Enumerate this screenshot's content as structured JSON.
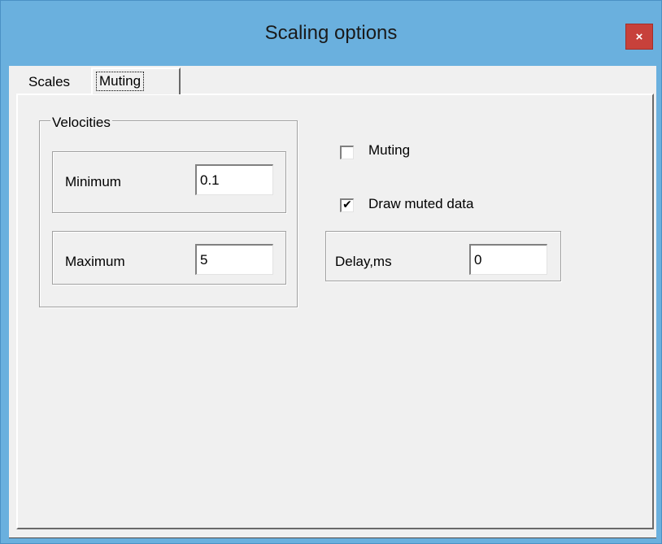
{
  "window": {
    "title": "Scaling options",
    "close_label": "×"
  },
  "tabs": [
    {
      "label": "Scales",
      "active": false
    },
    {
      "label": "Muting",
      "active": true
    }
  ],
  "velocities": {
    "group_label": "Velocities",
    "minimum": {
      "label": "Minimum",
      "value": "0.1"
    },
    "maximum": {
      "label": "Maximum",
      "value": "5"
    }
  },
  "options": {
    "muting": {
      "label": "Muting",
      "checked": false,
      "mark": ""
    },
    "draw_muted": {
      "label": "Draw muted data",
      "checked": true,
      "mark": "✔"
    }
  },
  "delay": {
    "label": "Delay,ms",
    "value": "0"
  }
}
